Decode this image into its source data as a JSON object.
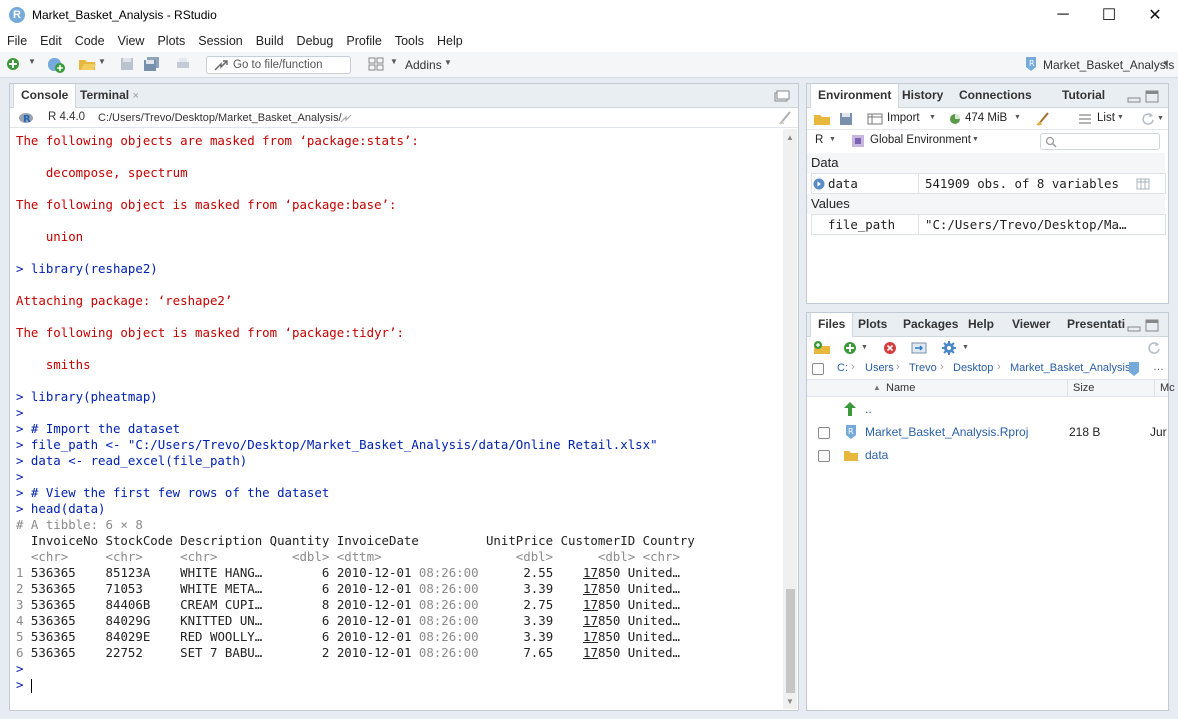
{
  "window": {
    "title": "Market_Basket_Analysis - RStudio",
    "minimize": "─",
    "maximize": "☐",
    "close": "✕"
  },
  "menu": [
    "File",
    "Edit",
    "Code",
    "View",
    "Plots",
    "Session",
    "Build",
    "Debug",
    "Profile",
    "Tools",
    "Help"
  ],
  "toolbar": {
    "goto_placeholder": "Go to file/function",
    "addins": "Addins",
    "project": "Market_Basket_Analysis"
  },
  "console": {
    "tabs": [
      "Console",
      "Terminal"
    ],
    "r_version": "R 4.4.0",
    "path": "C:/Users/Trevo/Desktop/Market_Basket_Analysis/",
    "lines": [
      {
        "t": "The following objects are masked from ‘package:stats’:",
        "c": "red"
      },
      {
        "t": "",
        "c": ""
      },
      {
        "t": "    decompose, spectrum",
        "c": "red"
      },
      {
        "t": "",
        "c": ""
      },
      {
        "t": "The following object is masked from ‘package:base’:",
        "c": "red"
      },
      {
        "t": "",
        "c": ""
      },
      {
        "t": "    union",
        "c": "red"
      },
      {
        "t": "",
        "c": ""
      },
      {
        "t": "> library(reshape2)",
        "c": "blue"
      },
      {
        "t": "",
        "c": ""
      },
      {
        "t": "Attaching package: ‘reshape2’",
        "c": "red"
      },
      {
        "t": "",
        "c": ""
      },
      {
        "t": "The following object is masked from ‘package:tidyr’:",
        "c": "red"
      },
      {
        "t": "",
        "c": ""
      },
      {
        "t": "    smiths",
        "c": "red"
      },
      {
        "t": "",
        "c": ""
      },
      {
        "t": "> library(pheatmap)",
        "c": "blue"
      },
      {
        "t": ">",
        "c": "blue"
      },
      {
        "t": "> # Import the dataset",
        "c": "blue"
      },
      {
        "t": "> file_path <- \"C:/Users/Trevo/Desktop/Market_Basket_Analysis/data/Online Retail.xlsx\"",
        "c": "blue"
      },
      {
        "t": "> data <- read_excel(file_path)",
        "c": "blue"
      },
      {
        "t": ">",
        "c": "blue"
      },
      {
        "t": "> # View the first few rows of the dataset",
        "c": "blue"
      },
      {
        "t": "> head(data)",
        "c": "blue"
      },
      {
        "t": "# A tibble: 6 × 8",
        "c": "gray"
      },
      {
        "t": "  InvoiceNo StockCode Description Quantity InvoiceDate         UnitPrice CustomerID Country",
        "c": ""
      },
      {
        "t": "  <chr>     <chr>     <chr>          <dbl> <dttm>                  <dbl>      <dbl> <chr>",
        "c": "gray"
      }
    ],
    "rows": [
      {
        "n": "1",
        "inv": "536365",
        "stock": "85123A",
        "desc": "WHITE HANG…",
        "qty": "6",
        "date": "2010-12-01",
        "time": "08:26:00",
        "price": "2.55",
        "cid_a": "17",
        "cid_b": "850",
        "country": "United…"
      },
      {
        "n": "2",
        "inv": "536365",
        "stock": "71053",
        "desc": "WHITE META…",
        "qty": "6",
        "date": "2010-12-01",
        "time": "08:26:00",
        "price": "3.39",
        "cid_a": "17",
        "cid_b": "850",
        "country": "United…"
      },
      {
        "n": "3",
        "inv": "536365",
        "stock": "84406B",
        "desc": "CREAM CUPI…",
        "qty": "8",
        "date": "2010-12-01",
        "time": "08:26:00",
        "price": "2.75",
        "cid_a": "17",
        "cid_b": "850",
        "country": "United…"
      },
      {
        "n": "4",
        "inv": "536365",
        "stock": "84029G",
        "desc": "KNITTED UN…",
        "qty": "6",
        "date": "2010-12-01",
        "time": "08:26:00",
        "price": "3.39",
        "cid_a": "17",
        "cid_b": "850",
        "country": "United…"
      },
      {
        "n": "5",
        "inv": "536365",
        "stock": "84029E",
        "desc": "RED WOOLLY…",
        "qty": "6",
        "date": "2010-12-01",
        "time": "08:26:00",
        "price": "3.39",
        "cid_a": "17",
        "cid_b": "850",
        "country": "United…"
      },
      {
        "n": "6",
        "inv": "536365",
        "stock": "22752",
        "desc": "SET 7 BABU…",
        "qty": "2",
        "date": "2010-12-01",
        "time": "08:26:00",
        "price": "7.65",
        "cid_a": "17",
        "cid_b": "850",
        "country": "United…"
      }
    ],
    "trailing": [
      ">",
      ">"
    ]
  },
  "environment": {
    "tabs": [
      "Environment",
      "History",
      "Connections",
      "Tutorial"
    ],
    "import": "Import",
    "memory": "474 MiB",
    "list_view": "List",
    "lang": "R",
    "scope": "Global Environment",
    "sections": {
      "data": "Data",
      "values": "Values"
    },
    "data_rows": [
      {
        "name": "data",
        "value": "541909 obs. of 8 variables"
      }
    ],
    "value_rows": [
      {
        "name": "file_path",
        "value": "\"C:/Users/Trevo/Desktop/Ma…"
      }
    ]
  },
  "files": {
    "tabs": [
      "Files",
      "Plots",
      "Packages",
      "Help",
      "Viewer",
      "Presentati"
    ],
    "breadcrumb": [
      "C:",
      "Users",
      "Trevo",
      "Desktop",
      "Market_Basket_Analysis"
    ],
    "more": "…",
    "columns": {
      "name": "Name",
      "size": "Size",
      "modified": "Mc"
    },
    "parent": "..",
    "items": [
      {
        "name": "Market_Basket_Analysis.Rproj",
        "size": "218 B",
        "modified": "Jur"
      },
      {
        "name": "data",
        "size": "",
        "modified": ""
      }
    ]
  }
}
